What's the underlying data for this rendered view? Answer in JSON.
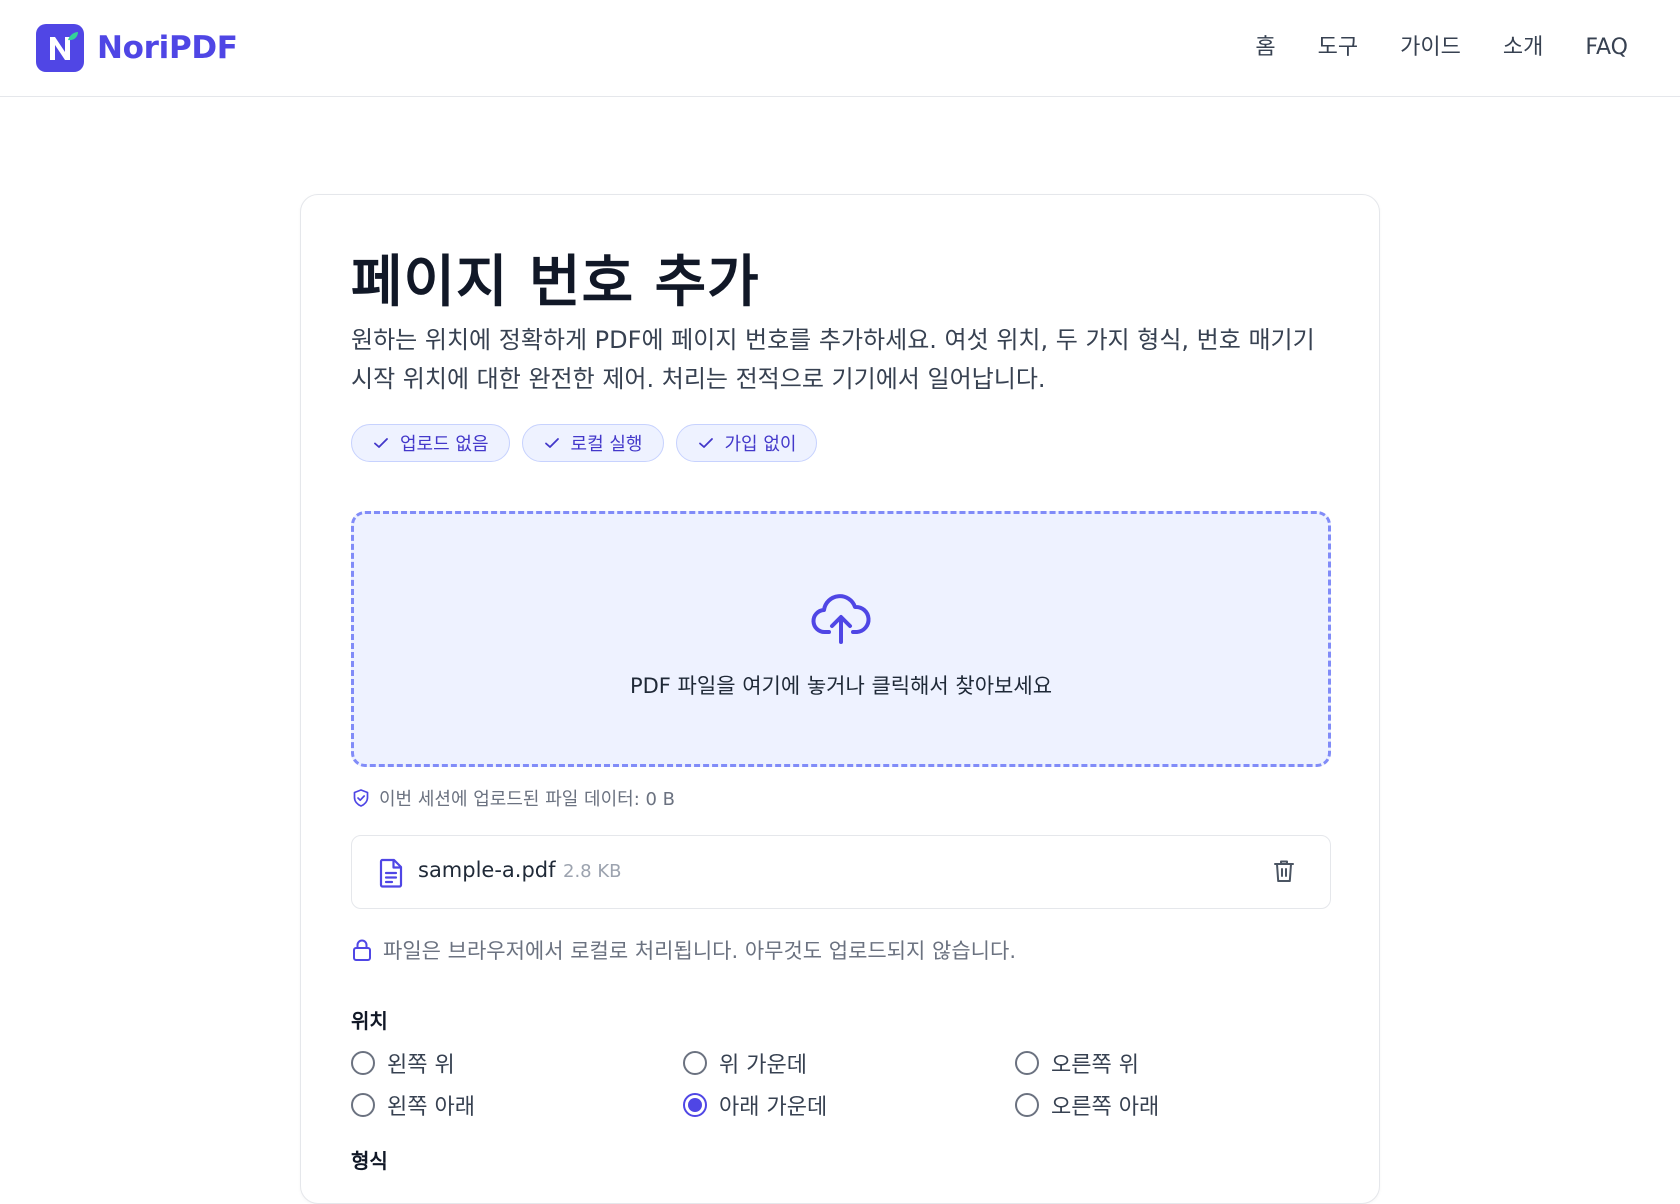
{
  "header": {
    "logo_text": "NoriPDF",
    "nav": [
      "홈",
      "도구",
      "가이드",
      "소개",
      "FAQ"
    ]
  },
  "tool": {
    "title": "페이지 번호 추가",
    "description": "원하는 위치에 정확하게 PDF에 페이지 번호를 추가하세요. 여섯 위치, 두 가지 형식, 번호 매기기 시작 위치에 대한 완전한 제어. 처리는 전적으로 기기에서 일어납니다.",
    "badges": [
      "업로드 없음",
      "로컬 실행",
      "가입 없이"
    ]
  },
  "dropzone": {
    "text": "PDF 파일을 여기에 놓거나 클릭해서 찾아보세요"
  },
  "session_info": "이번 세션에 업로드된 파일 데이터: 0 B",
  "file": {
    "name": "sample-a.pdf",
    "size": "2.8 KB"
  },
  "local_note": "파일은 브라우저에서 로컬로 처리됩니다. 아무것도 업로드되지 않습니다.",
  "position": {
    "label": "위치",
    "options": [
      "왼쪽 위",
      "위 가운데",
      "오른쪽 위",
      "왼쪽 아래",
      "아래 가운데",
      "오른쪽 아래"
    ],
    "selected": "아래 가운데"
  },
  "format": {
    "label": "형식"
  },
  "colors": {
    "accent": "#4f46e5",
    "badge_bg": "#eef2ff",
    "dropzone_border": "#818cf8"
  }
}
